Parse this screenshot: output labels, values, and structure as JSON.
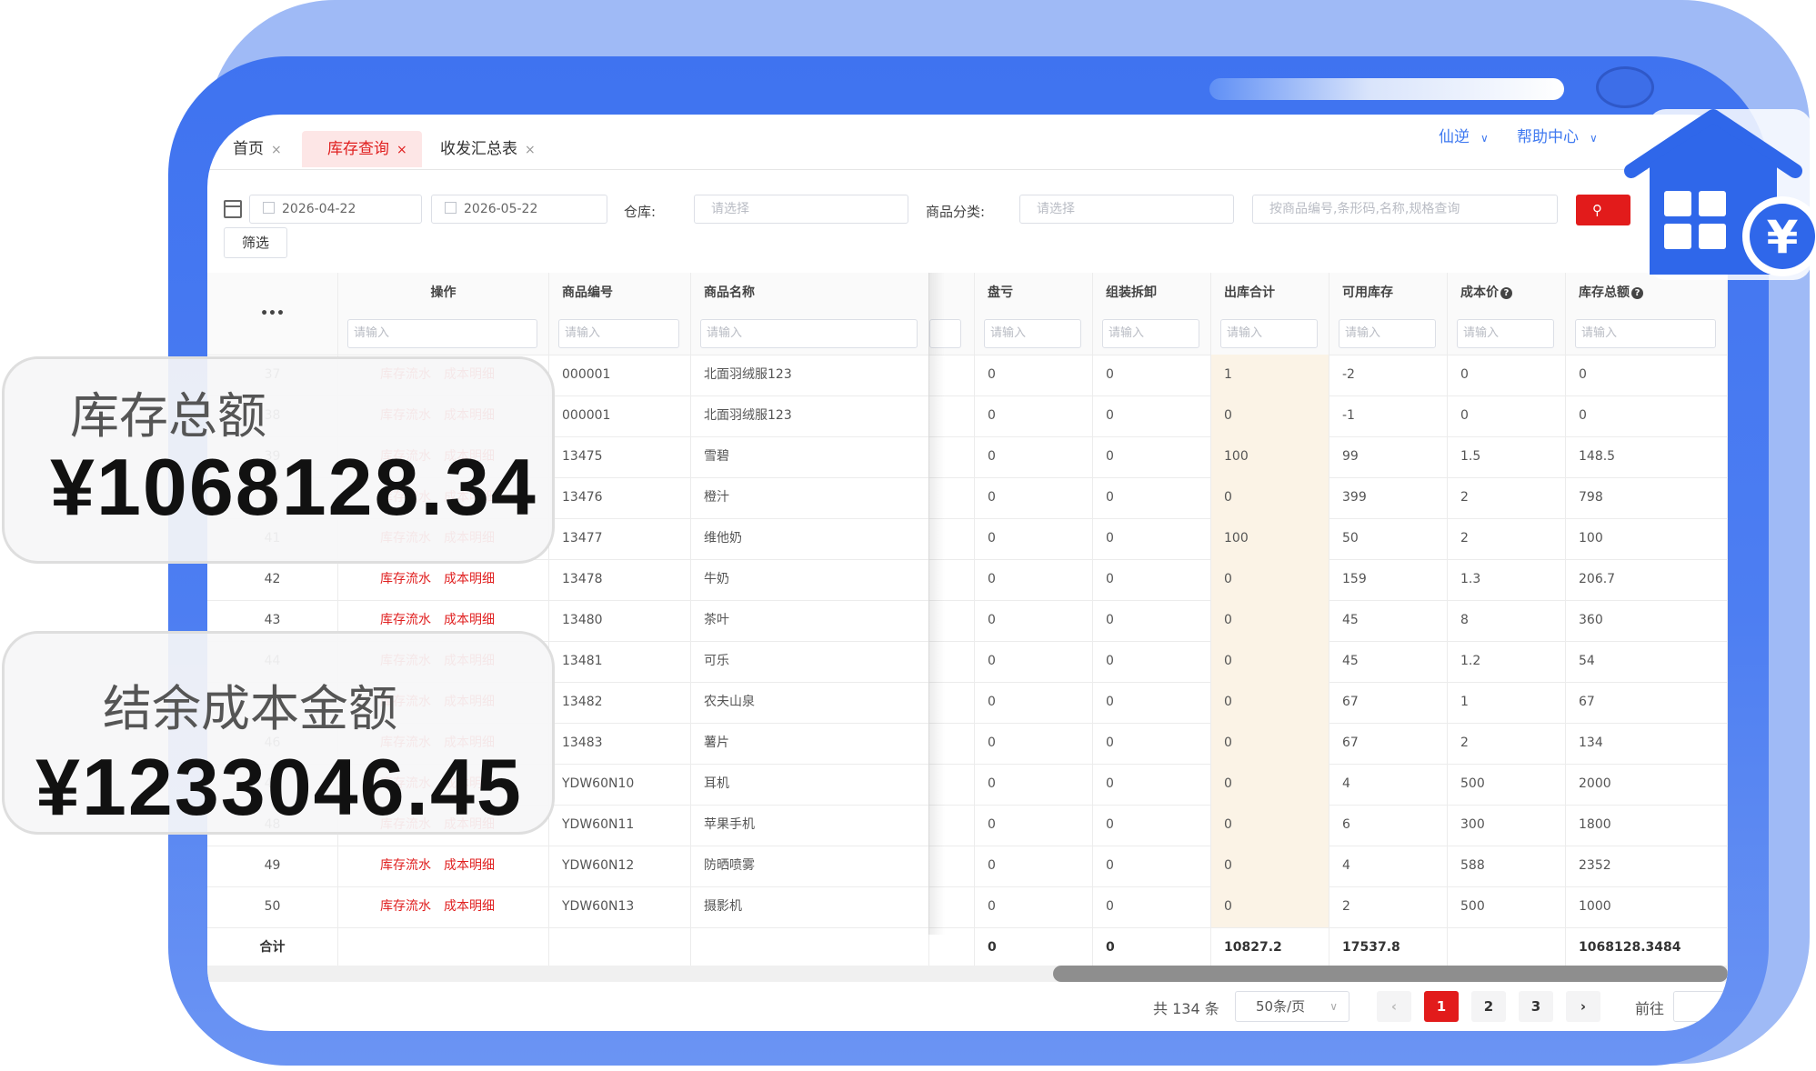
{
  "tabs": [
    {
      "label": "首页",
      "close": "×"
    },
    {
      "label": "库存查询",
      "close": "×"
    },
    {
      "label": "收发汇总表",
      "close": "×"
    }
  ],
  "top_right": {
    "user": "仙逆",
    "help": "帮助中心"
  },
  "filters": {
    "date_start": "2026-04-22",
    "date_end": "2026-05-22",
    "warehouse_label": "仓库:",
    "warehouse_placeholder": "请选择",
    "category_label": "商品分类:",
    "category_placeholder": "请选择",
    "keyword_placeholder": "按商品编号,条形码,名称,规格查询",
    "filter_button": "筛选"
  },
  "table": {
    "columns": {
      "more": "•••",
      "op": "操作",
      "code": "商品编号",
      "name": "商品名称",
      "loss": "盘亏",
      "assembly": "组装拆卸",
      "out_total": "出库合计",
      "available": "可用库存",
      "cost": "成本价",
      "total_value": "库存总额"
    },
    "filter_placeholder": "请输入",
    "op_links": {
      "flow": "库存流水",
      "cost": "成本明细"
    },
    "rows": [
      {
        "idx": "37",
        "code": "000001",
        "name": "北面羽绒服123",
        "loss": "0",
        "assembly": "0",
        "out_total": "1",
        "available": "-2",
        "cost": "0",
        "total_value": "0"
      },
      {
        "idx": "38",
        "code": "000001",
        "name": "北面羽绒服123",
        "loss": "0",
        "assembly": "0",
        "out_total": "0",
        "available": "-1",
        "cost": "0",
        "total_value": "0"
      },
      {
        "idx": "39",
        "code": "13475",
        "name": "雪碧",
        "loss": "0",
        "assembly": "0",
        "out_total": "100",
        "available": "99",
        "cost": "1.5",
        "total_value": "148.5"
      },
      {
        "idx": "40",
        "code": "13476",
        "name": "橙汁",
        "loss": "0",
        "assembly": "0",
        "out_total": "0",
        "available": "399",
        "cost": "2",
        "total_value": "798"
      },
      {
        "idx": "41",
        "code": "13477",
        "name": "维他奶",
        "loss": "0",
        "assembly": "0",
        "out_total": "100",
        "available": "50",
        "cost": "2",
        "total_value": "100"
      },
      {
        "idx": "42",
        "code": "13478",
        "name": "牛奶",
        "loss": "0",
        "assembly": "0",
        "out_total": "0",
        "available": "159",
        "cost": "1.3",
        "total_value": "206.7"
      },
      {
        "idx": "43",
        "code": "13480",
        "name": "茶叶",
        "loss": "0",
        "assembly": "0",
        "out_total": "0",
        "available": "45",
        "cost": "8",
        "total_value": "360"
      },
      {
        "idx": "44",
        "code": "13481",
        "name": "可乐",
        "loss": "0",
        "assembly": "0",
        "out_total": "0",
        "available": "45",
        "cost": "1.2",
        "total_value": "54"
      },
      {
        "idx": "45",
        "code": "13482",
        "name": "农夫山泉",
        "loss": "0",
        "assembly": "0",
        "out_total": "0",
        "available": "67",
        "cost": "1",
        "total_value": "67"
      },
      {
        "idx": "46",
        "code": "13483",
        "name": "薯片",
        "loss": "0",
        "assembly": "0",
        "out_total": "0",
        "available": "67",
        "cost": "2",
        "total_value": "134"
      },
      {
        "idx": "47",
        "code": "YDW60N10",
        "name": "耳机",
        "loss": "0",
        "assembly": "0",
        "out_total": "0",
        "available": "4",
        "cost": "500",
        "total_value": "2000"
      },
      {
        "idx": "48",
        "code": "YDW60N11",
        "name": "苹果手机",
        "loss": "0",
        "assembly": "0",
        "out_total": "0",
        "available": "6",
        "cost": "300",
        "total_value": "1800"
      },
      {
        "idx": "49",
        "code": "YDW60N12",
        "name": "防晒喷雾",
        "loss": "0",
        "assembly": "0",
        "out_total": "0",
        "available": "4",
        "cost": "588",
        "total_value": "2352"
      },
      {
        "idx": "50",
        "code": "YDW60N13",
        "name": "摄影机",
        "loss": "0",
        "assembly": "0",
        "out_total": "0",
        "available": "2",
        "cost": "500",
        "total_value": "1000"
      }
    ],
    "totals": {
      "label": "合计",
      "loss": "0",
      "assembly": "0",
      "out_total": "10827.2",
      "available": "17537.8",
      "total_value": "1068128.3484"
    }
  },
  "pagination": {
    "total": "共 134 条",
    "page_size": "50条/页",
    "prev": "‹",
    "pages": [
      "1",
      "2",
      "3"
    ],
    "next": "›",
    "goto": "前往"
  },
  "cards": {
    "stock_total_title": "库存总额",
    "stock_total_value": "¥1068128.34",
    "remaining_cost_title": "结余成本金额",
    "remaining_cost_value": "¥1233046.45"
  },
  "badge": {
    "currency_symbol": "¥"
  },
  "colors": {
    "accent_red": "#e21b1b",
    "link_blue": "#3f79f0",
    "frame_blue": "#3f73f0"
  }
}
